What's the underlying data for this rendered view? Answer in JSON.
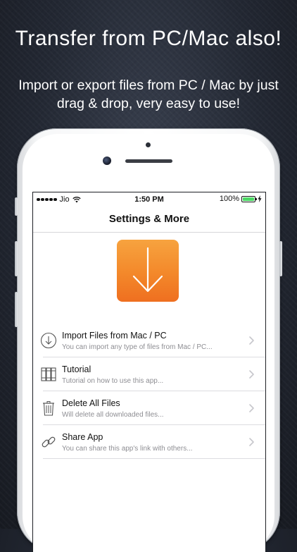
{
  "promo": {
    "headline": "Transfer from PC/Mac also!",
    "subtext": "Import or export files from PC / Mac by just drag & drop, very easy to use!"
  },
  "status_bar": {
    "carrier": "Jio",
    "time": "1:50 PM",
    "battery_percent": "100%",
    "battery_level": 1.0,
    "signal_bars": 5
  },
  "nav": {
    "title": "Settings & More"
  },
  "app_icon": {
    "icon": "download-arrow-icon",
    "color_top": "#f7a33f",
    "color_bottom": "#ef6f20"
  },
  "menu": {
    "items": [
      {
        "icon": "download-circle-icon",
        "title": "Import Files from Mac / PC",
        "subtitle": "You can import any type of files from Mac / PC..."
      },
      {
        "icon": "books-icon",
        "title": "Tutorial",
        "subtitle": "Tutorial on how to use this app..."
      },
      {
        "icon": "trash-icon",
        "title": "Delete All Files",
        "subtitle": "Will delete all downloaded files..."
      },
      {
        "icon": "link-icon",
        "title": "Share App",
        "subtitle": "You can share this app's link with others..."
      }
    ]
  },
  "colors": {
    "accent_battery": "#4cd964",
    "separator": "#dcdce0",
    "subtitle_text": "#8e8e93"
  }
}
